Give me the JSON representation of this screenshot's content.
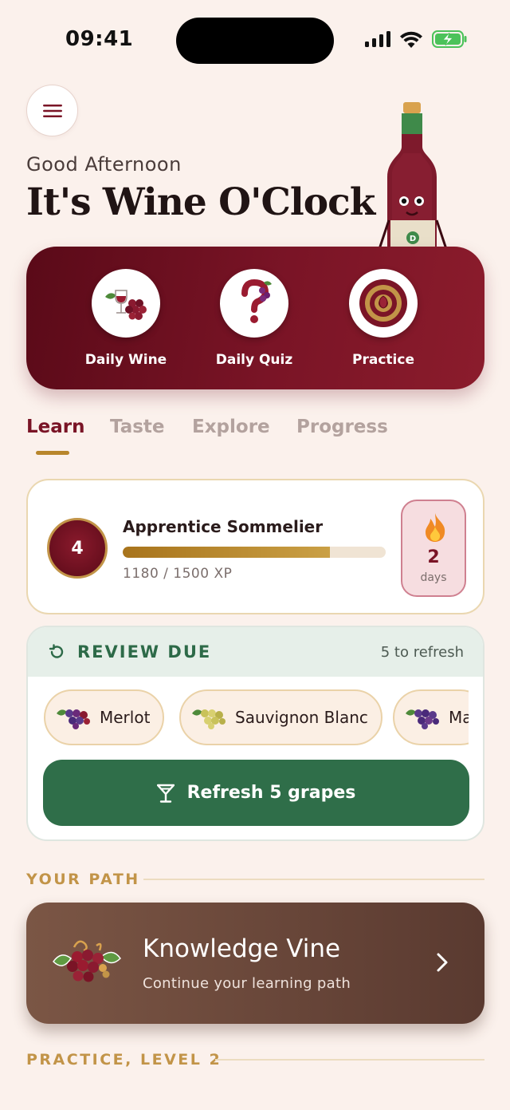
{
  "status": {
    "time": "09:41"
  },
  "header": {
    "greeting": "Good Afternoon",
    "headline": "It's Wine O'Clock"
  },
  "quick_actions": [
    {
      "label": "Daily Wine",
      "icon": "wine-grapes-icon"
    },
    {
      "label": "Daily Quiz",
      "icon": "question-grapes-icon"
    },
    {
      "label": "Practice",
      "icon": "target-icon"
    }
  ],
  "tabs": [
    {
      "label": "Learn",
      "active": true
    },
    {
      "label": "Taste",
      "active": false
    },
    {
      "label": "Explore",
      "active": false
    },
    {
      "label": "Progress",
      "active": false
    }
  ],
  "level": {
    "number": "4",
    "title": "Apprentice Sommelier",
    "xp_text": "1180 / 1500 XP",
    "xp_current": 1180,
    "xp_total": 1500,
    "streak_count": "2",
    "streak_unit": "days"
  },
  "review": {
    "title": "REVIEW DUE",
    "count_text": "5 to refresh",
    "chips": [
      {
        "label": "Merlot",
        "icon": "red-grapes-icon"
      },
      {
        "label": "Sauvignon Blanc",
        "icon": "white-grapes-icon"
      },
      {
        "label": "Ma",
        "icon": "red-grapes-icon"
      }
    ],
    "button_label": "Refresh 5 grapes"
  },
  "sections": {
    "your_path": "YOUR PATH",
    "practice": "PRACTICE, LEVEL 2"
  },
  "path_card": {
    "title": "Knowledge Vine",
    "subtitle": "Continue your learning path"
  },
  "colors": {
    "burgundy": "#7a1426",
    "gold": "#c29448",
    "green": "#2f6e49",
    "background": "#fbf1ec"
  }
}
